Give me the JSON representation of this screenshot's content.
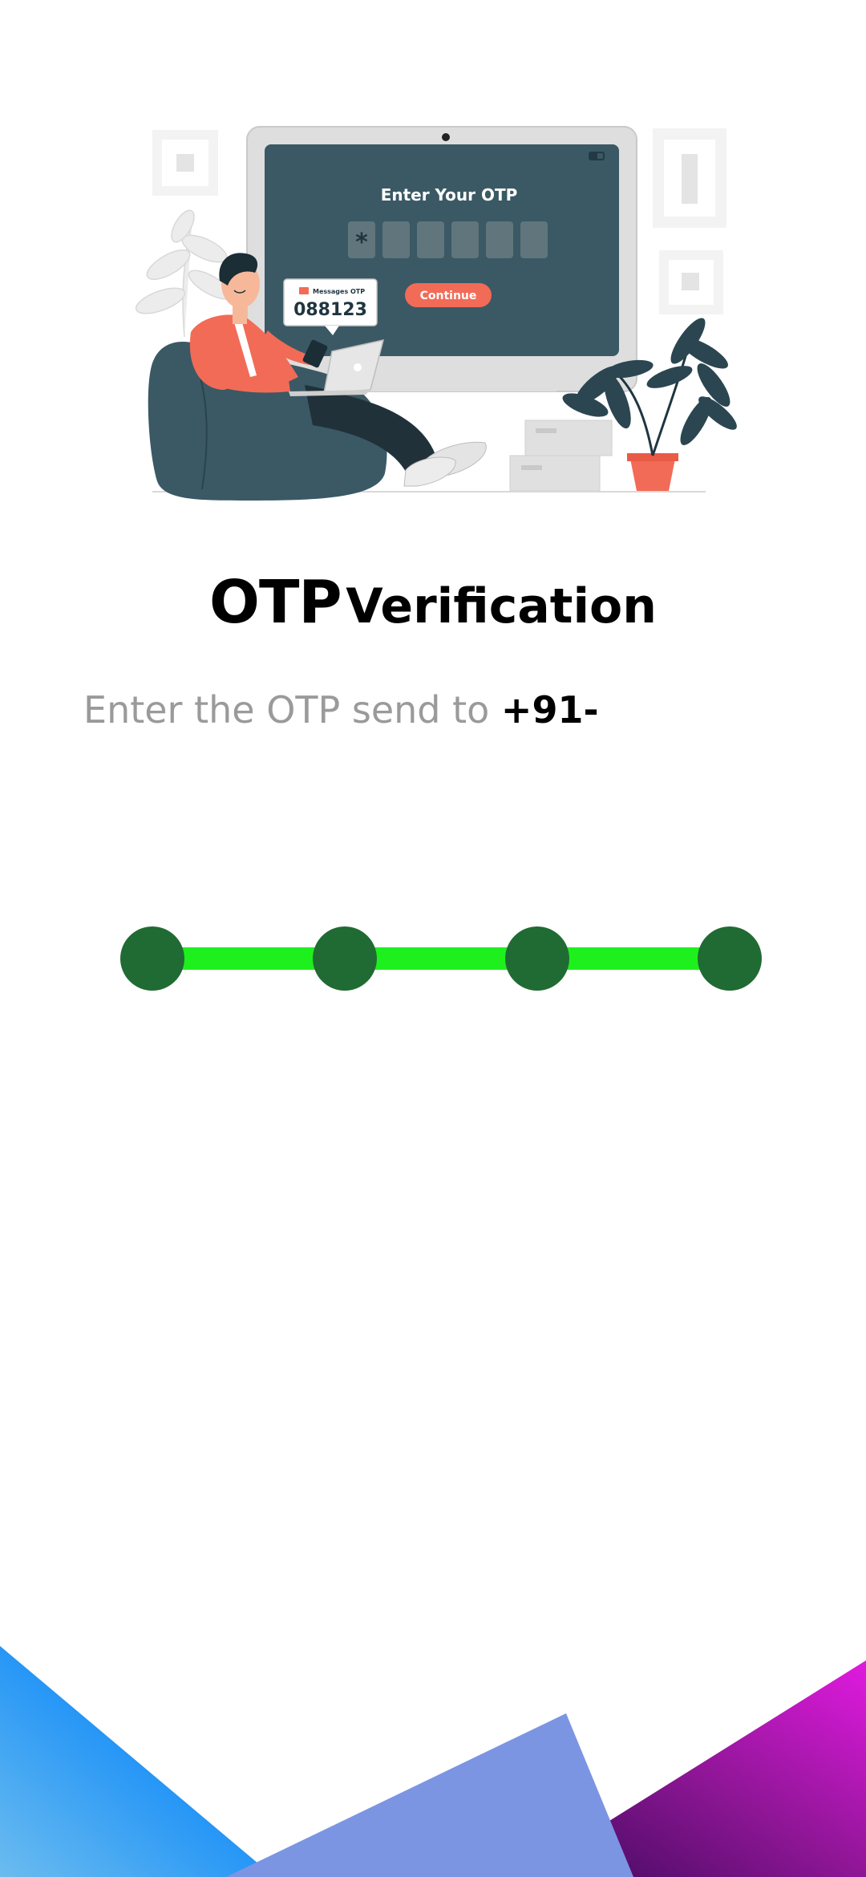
{
  "illustration": {
    "screen_title": "Enter Your OTP",
    "screen_button": "Continue",
    "bubble_label": "Messages OTP",
    "bubble_code": "088123",
    "first_box_char": "*"
  },
  "title": {
    "part1": "OTP",
    "part2": "Verification"
  },
  "subtitle": {
    "lead": "Enter the OTP send to",
    "phone": "+91-"
  },
  "otp_progress": {
    "steps_total": 4
  },
  "colors": {
    "step_dot": "#206b33",
    "step_line": "#1ef01e",
    "accent": "#f26b57",
    "screen": "#3a5965",
    "gradient_left": "#1e90ff",
    "gradient_center": "#7b95e3",
    "gradient_right": "#c318d6"
  }
}
